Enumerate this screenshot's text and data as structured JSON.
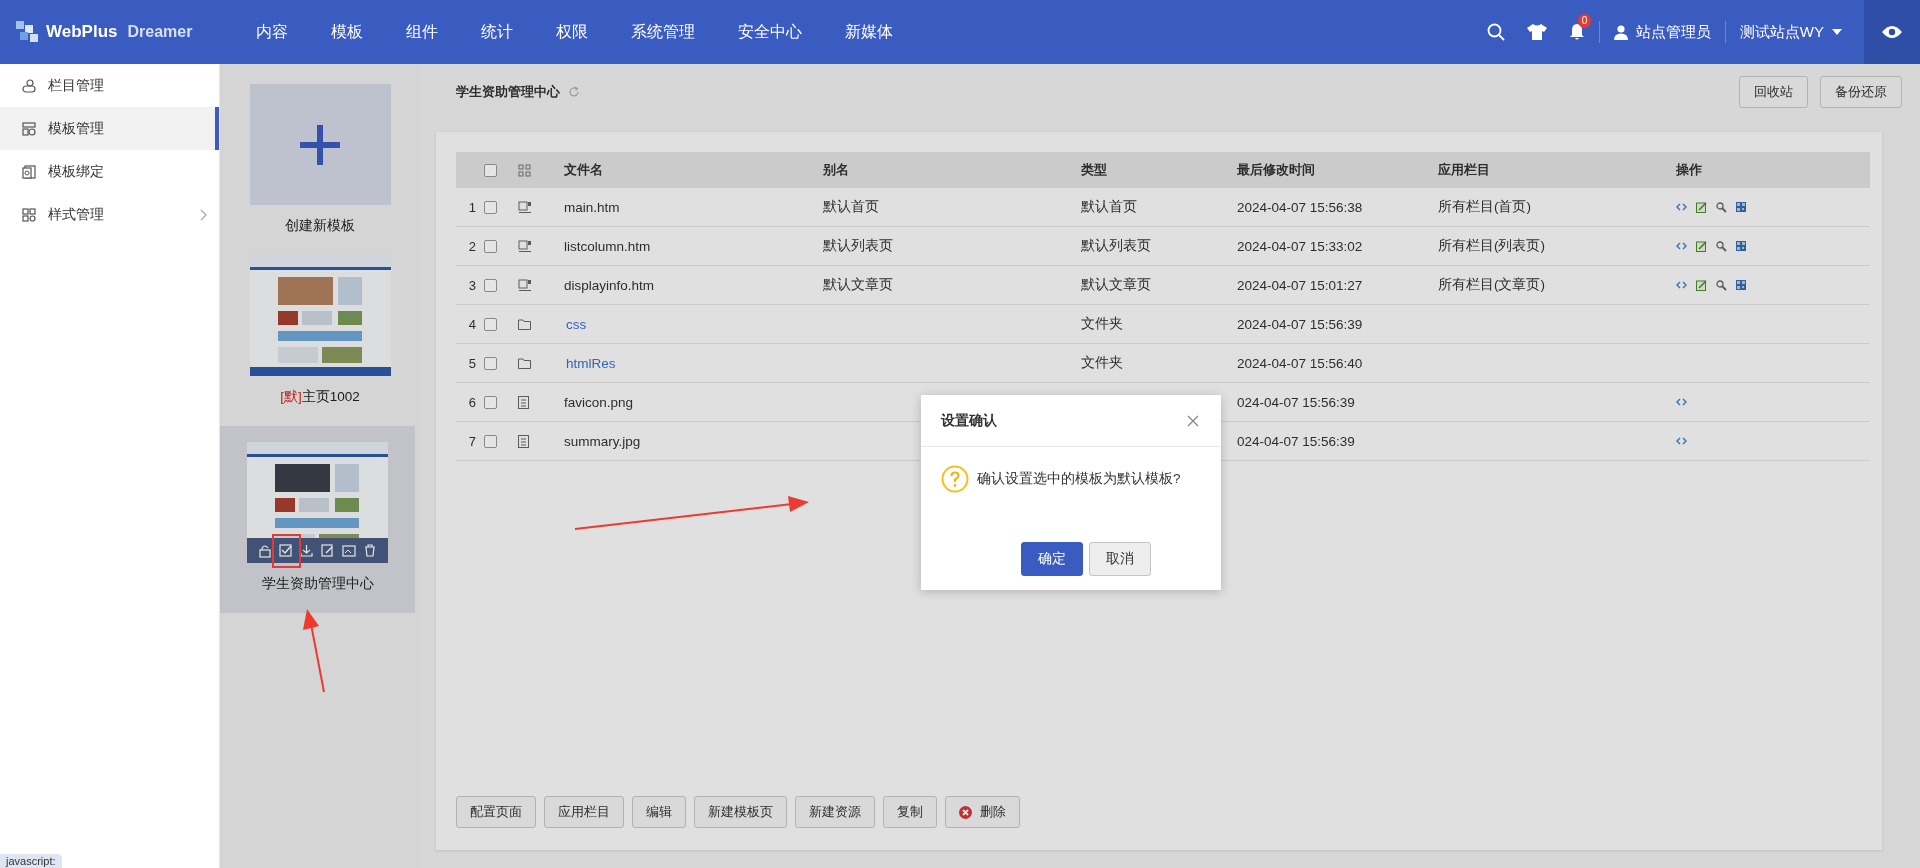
{
  "header": {
    "logo_main": "WebPlus",
    "logo_sub": "Dreamer",
    "nav": [
      {
        "label": "内容"
      },
      {
        "label": "模板"
      },
      {
        "label": "组件"
      },
      {
        "label": "统计"
      },
      {
        "label": "权限"
      },
      {
        "label": "系统管理"
      },
      {
        "label": "安全中心"
      },
      {
        "label": "新媒体"
      }
    ],
    "notification_count": "0",
    "user": "站点管理员",
    "site": "测试站点WY"
  },
  "sidebar": {
    "items": [
      {
        "label": "栏目管理",
        "selected": false,
        "expandable": false
      },
      {
        "label": "模板管理",
        "selected": true,
        "expandable": false
      },
      {
        "label": "模板绑定",
        "selected": false,
        "expandable": false
      },
      {
        "label": "样式管理",
        "selected": false,
        "expandable": true
      }
    ]
  },
  "templates": [
    {
      "kind": "create",
      "label": "创建新模板",
      "selected": false
    },
    {
      "kind": "template",
      "tag": "[默]",
      "label": "主页1002",
      "selected": false
    },
    {
      "kind": "template",
      "label": "学生资助管理中心",
      "selected": true
    }
  ],
  "main": {
    "title": "学生资助管理中心",
    "buttons": [
      "回收站",
      "备份还原"
    ],
    "table": {
      "columns": [
        "文件名",
        "别名",
        "类型",
        "最后修改时间",
        "应用栏目",
        "操作"
      ],
      "header_checked": false,
      "rows": [
        {
          "index": "1",
          "kind": "template",
          "checked": false,
          "name": "main.htm",
          "alias": "默认首页",
          "type": "默认首页",
          "modified": "2024-04-07 15:56:38",
          "applied": "所有栏目(首页)"
        },
        {
          "index": "2",
          "kind": "template",
          "checked": false,
          "name": "listcolumn.htm",
          "alias": "默认列表页",
          "type": "默认列表页",
          "modified": "2024-04-07 15:33:02",
          "applied": "所有栏目(列表页)"
        },
        {
          "index": "3",
          "kind": "template",
          "checked": false,
          "name": "displayinfo.htm",
          "alias": "默认文章页",
          "type": "默认文章页",
          "modified": "2024-04-07 15:01:27",
          "applied": "所有栏目(文章页)"
        },
        {
          "index": "4",
          "kind": "folder",
          "checked": false,
          "name": "css",
          "type": "文件夹",
          "modified": "2024-04-07 15:56:39"
        },
        {
          "index": "5",
          "kind": "folder",
          "checked": false,
          "name": "htmlRes",
          "type": "文件夹",
          "modified": "2024-04-07 15:56:40"
        },
        {
          "index": "6",
          "kind": "file",
          "checked": false,
          "name": "favicon.png",
          "modified": "024-04-07 15:56:39"
        },
        {
          "index": "7",
          "kind": "file",
          "checked": false,
          "name": "summary.jpg",
          "modified": "024-04-07 15:56:39"
        }
      ]
    },
    "bottom_buttons": [
      {
        "label": "配置页面",
        "kind": "plain"
      },
      {
        "label": "应用栏目",
        "kind": "plain"
      },
      {
        "label": "编辑",
        "kind": "plain"
      },
      {
        "label": "新建模板页",
        "kind": "plain"
      },
      {
        "label": "新建资源",
        "kind": "plain"
      },
      {
        "label": "复制",
        "kind": "plain"
      },
      {
        "label": "删除",
        "kind": "delete"
      }
    ]
  },
  "dialog": {
    "title": "设置确认",
    "message": "确认设置选中的模板为默认模板?",
    "buttons": [
      {
        "label": "确定",
        "kind": "primary"
      },
      {
        "label": "取消",
        "kind": "secondary"
      }
    ]
  },
  "status_bar": {
    "text": "javascript:"
  }
}
